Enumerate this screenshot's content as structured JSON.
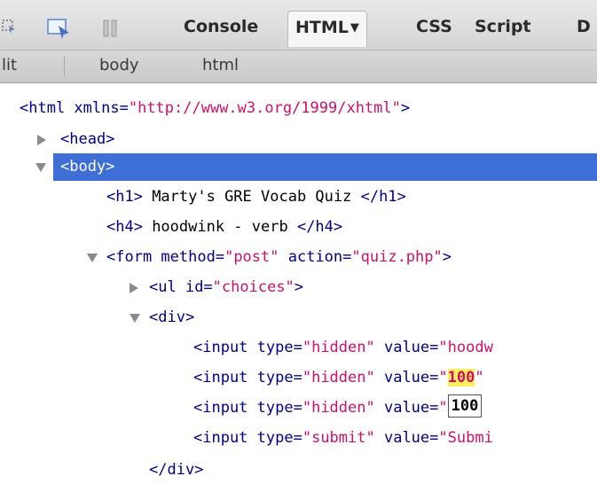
{
  "toolbar": {
    "tabs": [
      {
        "label": "Console",
        "active": false
      },
      {
        "label": "HTML",
        "active": true
      },
      {
        "label": "CSS",
        "active": false
      },
      {
        "label": "Script",
        "active": false
      },
      {
        "label": "D",
        "active": false
      }
    ],
    "icons": [
      "inspect-icon",
      "pointer-inspect-icon",
      "pause-icon"
    ]
  },
  "breadcrumb": {
    "edit_label": "lit",
    "items": [
      "body",
      "html"
    ]
  },
  "tree": {
    "html_open": {
      "tag": "<html",
      "attr": " xmlns=",
      "value": "\"http://www.w3.org/1999/xhtml\"",
      "close": ">"
    },
    "head": "<head>",
    "body": "<body>",
    "h1": {
      "open": "<h1>",
      "text": " Marty's GRE Vocab Quiz ",
      "close": "</h1>"
    },
    "h4": {
      "open": "<h4>",
      "text": " hoodwink - verb ",
      "close": "</h4>"
    },
    "form": {
      "tag": "<form",
      "attr1": " method=",
      "val1": "\"post\"",
      "attr2": " action=",
      "val2": "\"quiz.php\"",
      "close": ">"
    },
    "ul": {
      "tag": "<ul",
      "attr": " id=",
      "val": "\"choices\"",
      "close": ">"
    },
    "div": "<div>",
    "inputs": [
      {
        "tag": "<input",
        "attr1": " type=",
        "val1": "\"hidden\"",
        "attr2": " value=",
        "val2": "\"hoodw"
      },
      {
        "tag": "<input",
        "attr1": " type=",
        "val1": "\"hidden\"",
        "attr2": " value=",
        "val2_pre": "\"",
        "val2_hl": "100",
        "val2_post": "\""
      },
      {
        "tag": "<input",
        "attr1": " type=",
        "val1": "\"hidden\"",
        "attr2": " value=",
        "val2_pre": "\"",
        "edit_value": "100"
      },
      {
        "tag": "<input",
        "attr1": " type=",
        "val1": "\"submit\"",
        "attr2": " value=",
        "val2": "\"Submi"
      }
    ],
    "div_close": "</div>"
  },
  "colors": {
    "selection": "#3d6fd6",
    "tag": "#000088",
    "attr_value": "#cc1166",
    "highlight": "#ffef5a"
  }
}
